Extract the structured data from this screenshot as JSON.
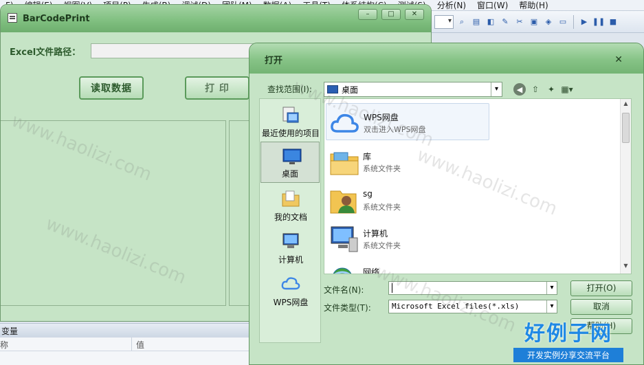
{
  "ide": {
    "menu": [
      "F)",
      "编辑(E)",
      "视图(V)",
      "项目(P)",
      "生成(B)",
      "调试(D)",
      "团队(M)",
      "数据(A)",
      "工具(T)",
      "体系结构(C)",
      "测试(S)",
      "分析(N)",
      "窗口(W)",
      "帮助(H)"
    ]
  },
  "app": {
    "title": "BarCodePrint",
    "path_label": "Excel文件路径：",
    "read_button": "读取数据",
    "print_button": "打 印"
  },
  "variables_panel": {
    "title": "变量",
    "col_name": "称",
    "col_value": "值"
  },
  "dialog": {
    "title": "打开",
    "lookin_label": "查找范围(I):",
    "lookin_value": "桌面",
    "places": [
      {
        "label": "最近使用的项目"
      },
      {
        "label": "桌面"
      },
      {
        "label": "我的文档"
      },
      {
        "label": "计算机"
      },
      {
        "label": "WPS网盘"
      }
    ],
    "files": [
      {
        "name": "WPS网盘",
        "sub": "双击进入WPS网盘"
      },
      {
        "name": "库",
        "sub": "系统文件夹"
      },
      {
        "name": "sg",
        "sub": "系统文件夹"
      },
      {
        "name": "计算机",
        "sub": "系统文件夹"
      },
      {
        "name": "网络",
        "sub": ""
      }
    ],
    "filename_label": "文件名(N):",
    "filename_value": "",
    "filetype_label": "文件类型(T):",
    "filetype_value": "Microsoft Excel files(*.xls)",
    "open_button": "打开(O)",
    "cancel_button": "取消",
    "help_button": "帮助(H)"
  },
  "watermark": {
    "text": "www.haolizi.com",
    "brand_main": "好例子网",
    "brand_sub": "开发实例分享交流平台"
  }
}
